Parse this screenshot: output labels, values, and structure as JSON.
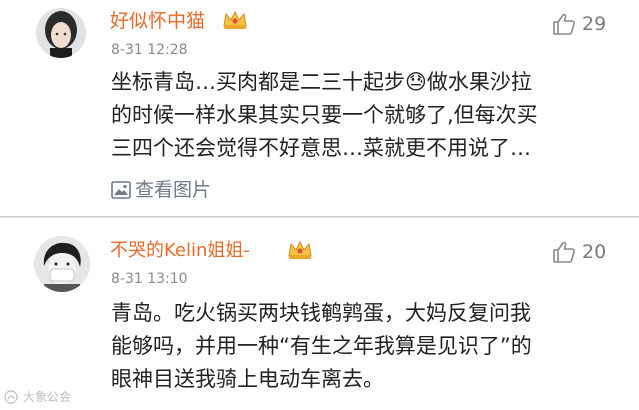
{
  "comments": [
    {
      "username": "好似怀中猫",
      "badge_icon": "crown-icon",
      "timestamp": "8-31 12:28",
      "likes": "29",
      "content": "坐标青岛…买肉都是二三十起步😓做水果沙拉\n的时候一样水果其实只要一个就够了,但每次买\n三四个还会觉得不好意思…菜就更不用说了…",
      "view_pictures": "查看图片"
    },
    {
      "username": "不哭的Kelin姐姐-",
      "badge_icon": "crown-icon",
      "timestamp": "8-31 13:10",
      "likes": "20",
      "content": "青岛。吃火锅买两块钱鹌鹑蛋，大妈反复问我\n能够吗，并用一种“有生之年我算是见识了”的\n眼神目送我骑上电动车离去。"
    }
  ],
  "watermark": "大象公会",
  "colors": {
    "username": "#e86a2a",
    "timestamp": "#8a8a8a",
    "link": "#6d7b8a",
    "text": "#222222"
  }
}
